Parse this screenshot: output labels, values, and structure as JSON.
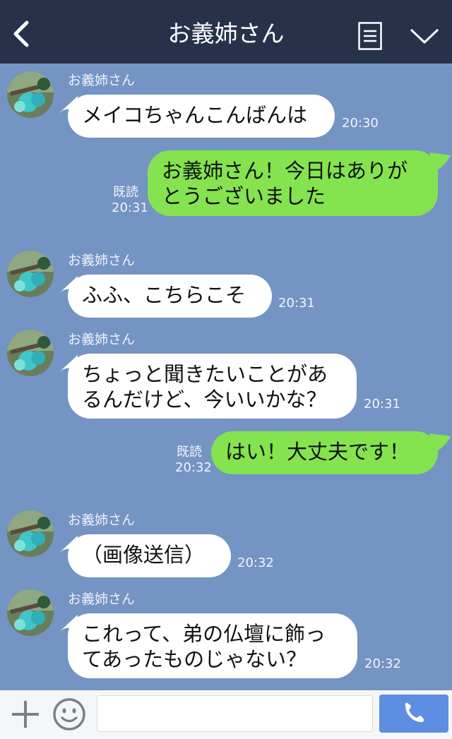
{
  "header": {
    "title": "お義姉さん"
  },
  "messages": [
    {
      "sender": "お義姉さん",
      "text": "メイコちゃんこんばんは",
      "time": "20:30"
    },
    {
      "text": "お義姉さん！今日はありが\nとうございました",
      "read": "既読",
      "time": "20:31"
    },
    {
      "sender": "お義姉さん",
      "text": "ふふ、こちらこそ",
      "time": "20:31"
    },
    {
      "sender": "お義姉さん",
      "text": "ちょっと聞きたいことがあ\nるんだけど、今いいかな？",
      "time": "20:31"
    },
    {
      "text": "はい！大丈夫です！",
      "read": "既読",
      "time": "20:32"
    },
    {
      "sender": "お義姉さん",
      "text": "（画像送信）",
      "time": "20:32"
    },
    {
      "sender": "お義姉さん",
      "text": "これって、弟の仏壇に飾っ\nてあったものじゃない？",
      "time": "20:32"
    }
  ],
  "input": {
    "placeholder": "",
    "value": ""
  },
  "icons": {
    "back": "chevron-left-icon",
    "menu": "list-icon",
    "collapse": "chevron-down-icon",
    "add": "plus-icon",
    "emoji": "smile-icon",
    "call": "phone-icon"
  },
  "colors": {
    "header": "#27324a",
    "background": "#7494c3",
    "incoming_bubble": "#ffffff",
    "outgoing_bubble": "#84e34f",
    "call_button": "#5d8ee2"
  }
}
